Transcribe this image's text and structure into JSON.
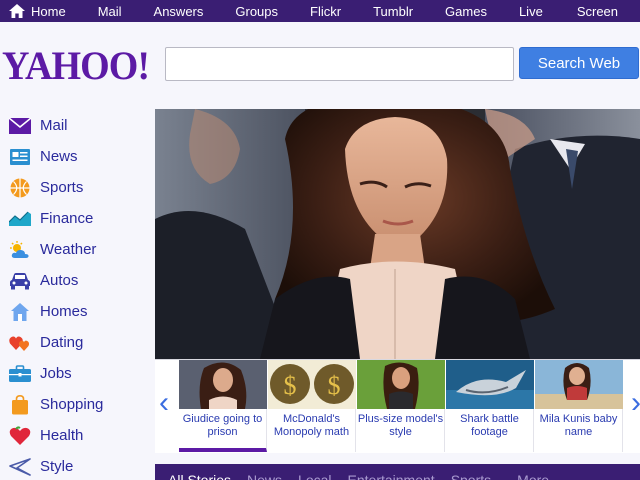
{
  "topnav": {
    "items": [
      "Home",
      "Mail",
      "Answers",
      "Groups",
      "Flickr",
      "Tumblr",
      "Games",
      "Live",
      "Screen"
    ],
    "icons": {
      "home": "home-icon"
    }
  },
  "header": {
    "logo": "YAHOO!",
    "search": {
      "value": "",
      "placeholder": ""
    },
    "search_button": "Search Web"
  },
  "sidebar": {
    "items": [
      {
        "label": "Mail",
        "icon": "mail-icon"
      },
      {
        "label": "News",
        "icon": "news-icon"
      },
      {
        "label": "Sports",
        "icon": "sports-icon"
      },
      {
        "label": "Finance",
        "icon": "finance-icon"
      },
      {
        "label": "Weather",
        "icon": "weather-icon"
      },
      {
        "label": "Autos",
        "icon": "autos-icon"
      },
      {
        "label": "Homes",
        "icon": "homes-icon"
      },
      {
        "label": "Dating",
        "icon": "dating-icon"
      },
      {
        "label": "Jobs",
        "icon": "jobs-icon"
      },
      {
        "label": "Shopping",
        "icon": "shopping-icon"
      },
      {
        "label": "Health",
        "icon": "health-icon"
      },
      {
        "label": "Style",
        "icon": "style-icon"
      }
    ]
  },
  "carousel": {
    "items": [
      {
        "caption": "Giudice going to prison"
      },
      {
        "caption": "McDonald's Monopoly math"
      },
      {
        "caption": "Plus-size model's style"
      },
      {
        "caption": "Shark battle footage"
      },
      {
        "caption": "Mila Kunis baby name"
      }
    ],
    "active_index": 0
  },
  "stories": {
    "tabs": [
      "All Stories",
      "News",
      "Local",
      "Entertainment",
      "Sports",
      "More"
    ]
  },
  "colors": {
    "brand_purple": "#5c1aa5",
    "nav_bg": "#3a1e73",
    "search_button": "#3f7fe2",
    "link_blue": "#2a2a9c"
  }
}
